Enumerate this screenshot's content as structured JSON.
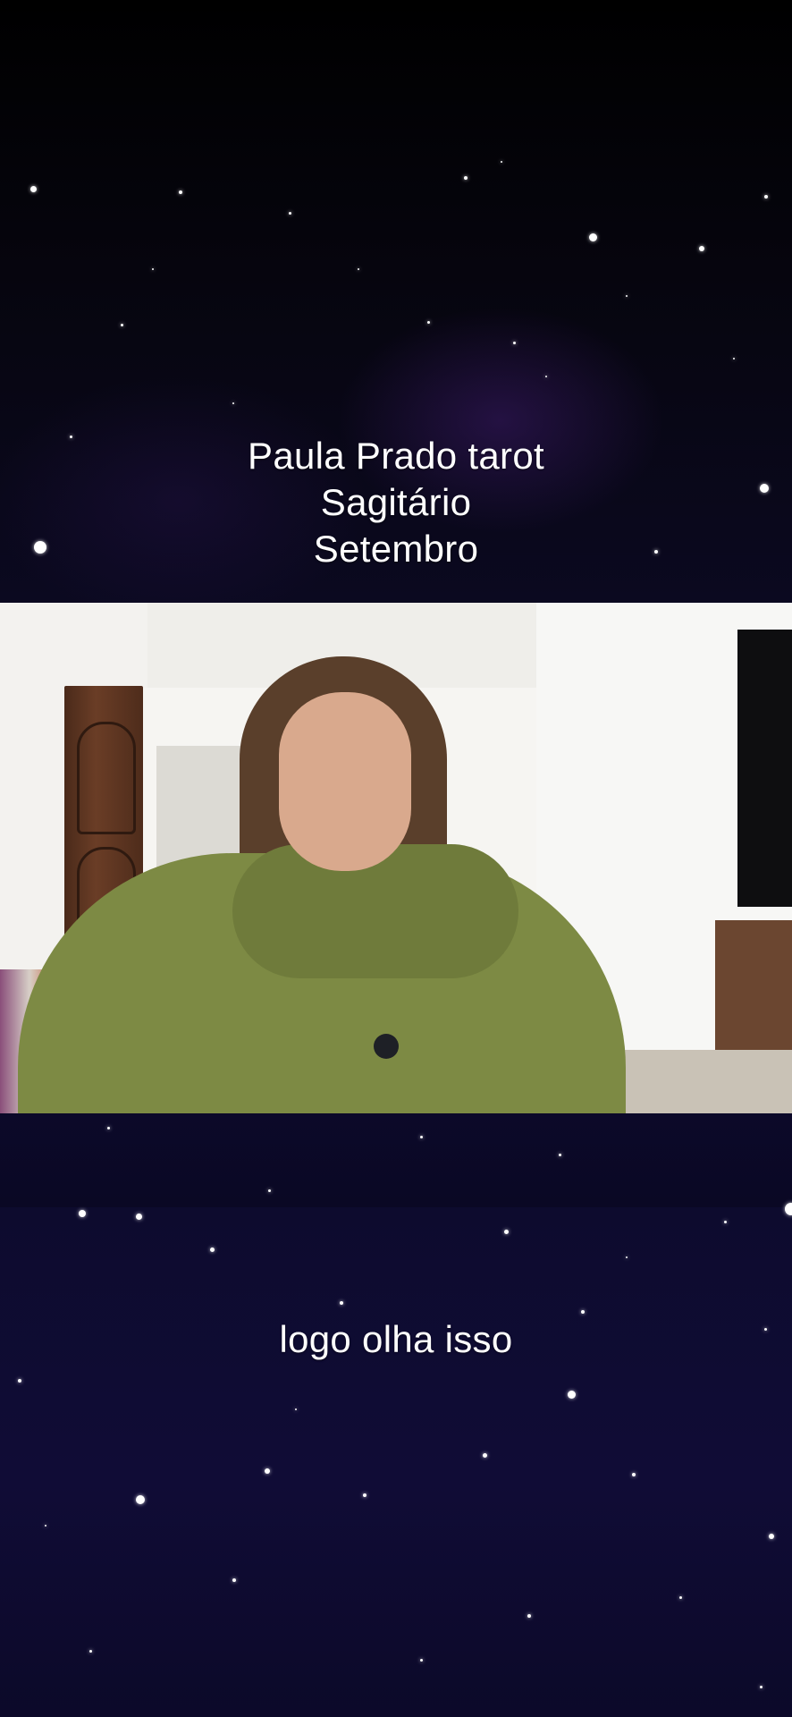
{
  "overlay_title": {
    "line1": "Paula Prado tarot",
    "line2": "Sagitário",
    "line3": "Setembro"
  },
  "subtitle": "logo olha isso",
  "video": {
    "description_icon": "video-frame-icon"
  },
  "colors": {
    "background_top": "#05040c",
    "background_bottom": "#100c36",
    "text": "#ffffff"
  }
}
